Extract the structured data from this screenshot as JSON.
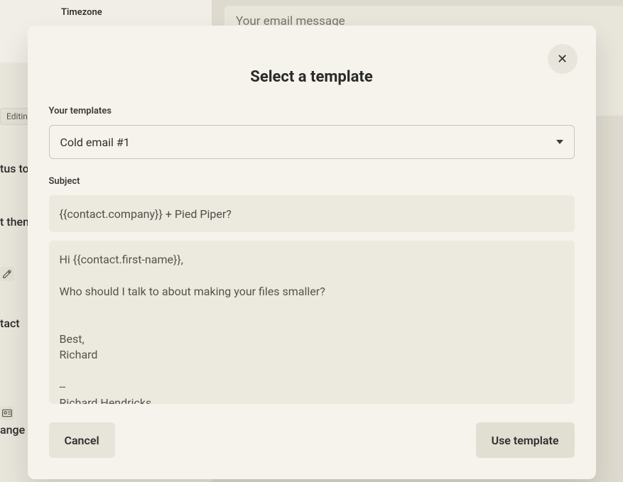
{
  "modal": {
    "title": "Select a template",
    "templates_label": "Your templates",
    "selected_template": "Cold email #1",
    "subject_label": "Subject",
    "subject_value": "{{contact.company}} + Pied Piper?",
    "body": "Hi {{contact.first-name}},\n\nWho should I talk to about making your files smaller?\n\n\nBest,\nRichard\n\n--\nRichard Hendricks\nFounder, Pied Piper",
    "cancel_label": "Cancel",
    "use_label": "Use template",
    "close_symbol": "✕"
  },
  "background": {
    "sidebar_heading": "Timezone",
    "edit_chip": "Editin",
    "frag1": "tus to",
    "frag2": "t then",
    "frag4": "tact",
    "frag5": "ange st",
    "email_placeholder": "Your email message"
  },
  "icons": {
    "edit": "edit-icon",
    "card": "card-icon"
  }
}
